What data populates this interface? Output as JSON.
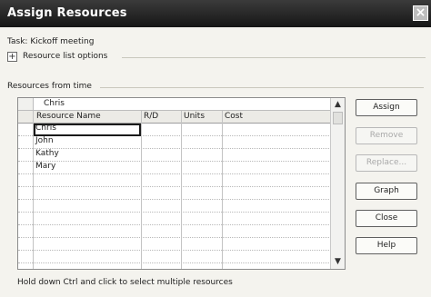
{
  "window": {
    "title": "Assign Resources",
    "close_glyph": "×"
  },
  "task": {
    "label": "Task: Kickoff meeting"
  },
  "options": {
    "toggle_glyph": "+",
    "label": "Resource list options"
  },
  "section": {
    "label": "Resources from time"
  },
  "grid": {
    "edit_value": "Chris",
    "columns": [
      "Resource Name",
      "R/D",
      "Units",
      "Cost"
    ],
    "rows": [
      "Chris",
      "John",
      "Kathy",
      "Mary",
      "",
      "",
      "",
      "",
      "",
      "",
      ""
    ]
  },
  "scrollbar": {
    "up_glyph": "▲",
    "down_glyph": "▼"
  },
  "buttons": {
    "assign": "Assign",
    "remove": "Remove",
    "replace": "Replace...",
    "graph": "Graph",
    "close": "Close",
    "help": "Help"
  },
  "footer": {
    "hint": "Hold down Ctrl and click to select multiple resources"
  }
}
